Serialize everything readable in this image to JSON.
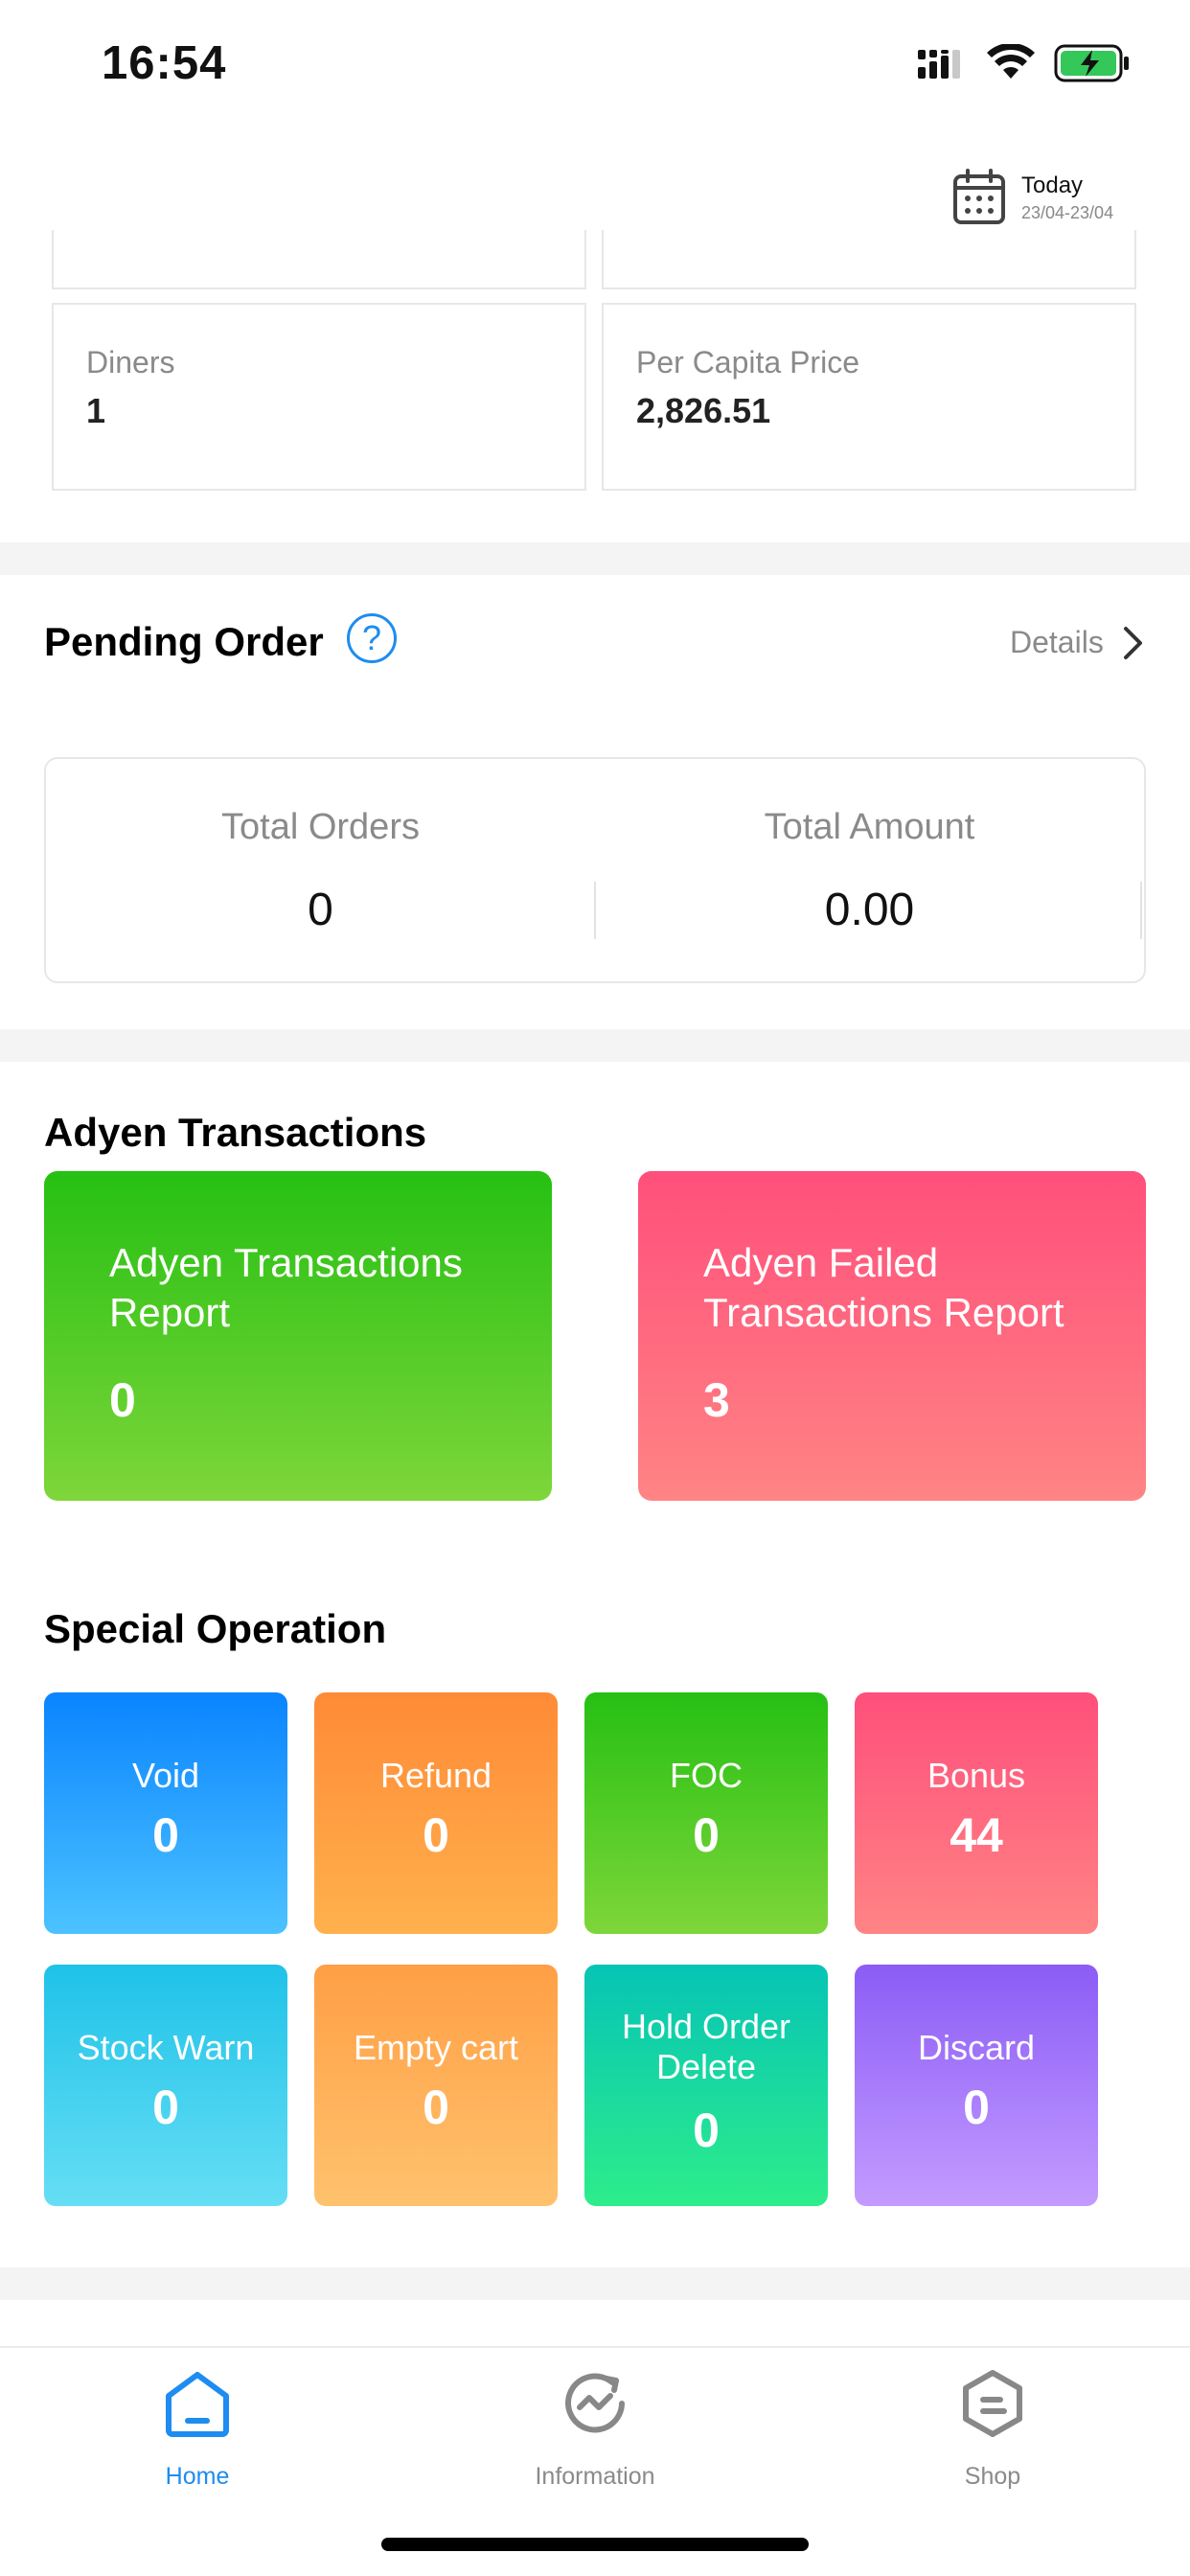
{
  "status_bar": {
    "time": "16:54"
  },
  "date_picker": {
    "label": "Today",
    "range": "23/04-23/04"
  },
  "stats": {
    "diners_label": "Diners",
    "diners_value": "1",
    "per_capita_label": "Per Capita Price",
    "per_capita_value": "2,826.51"
  },
  "pending_order": {
    "title": "Pending Order",
    "help": "?",
    "details": "Details",
    "total_orders_label": "Total Orders",
    "total_orders_value": "0",
    "total_amount_label": "Total Amount",
    "total_amount_value": "0.00"
  },
  "adyen": {
    "title": "Adyen Transactions",
    "report_label": "Adyen Transactions Report",
    "report_value": "0",
    "failed_label": "Adyen Failed Transactions Report",
    "failed_value": "3"
  },
  "special_operation": {
    "title": "Special Operation",
    "items": [
      {
        "label": "Void",
        "value": "0",
        "color_top": "#0a84ff",
        "color_bottom": "#4cc3ff"
      },
      {
        "label": "Refund",
        "value": "0",
        "color_top": "#ff8a36",
        "color_bottom": "#ffb14d"
      },
      {
        "label": "FOC",
        "value": "0",
        "color_top": "#26c013",
        "color_bottom": "#7ed63a"
      },
      {
        "label": "Bonus",
        "value": "44",
        "color_top": "#ff4f7b",
        "color_bottom": "#ff8484"
      },
      {
        "label": "Stock Warn",
        "value": "0",
        "color_top": "#1fc2e8",
        "color_bottom": "#66def5"
      },
      {
        "label": "Empty cart",
        "value": "0",
        "color_top": "#ff9f45",
        "color_bottom": "#ffc26d"
      },
      {
        "label": "Hold Order Delete",
        "value": "0",
        "color_top": "#06c4b5",
        "color_bottom": "#2ded8b"
      },
      {
        "label": "Discard",
        "value": "0",
        "color_top": "#8c5cf6",
        "color_bottom": "#c39bff"
      }
    ]
  },
  "tabs": [
    {
      "label": "Home",
      "active": true
    },
    {
      "label": "Information",
      "active": false
    },
    {
      "label": "Shop",
      "active": false
    }
  ],
  "colors": {
    "accent": "#1e8cf0",
    "inactive": "#8a8a8a"
  }
}
